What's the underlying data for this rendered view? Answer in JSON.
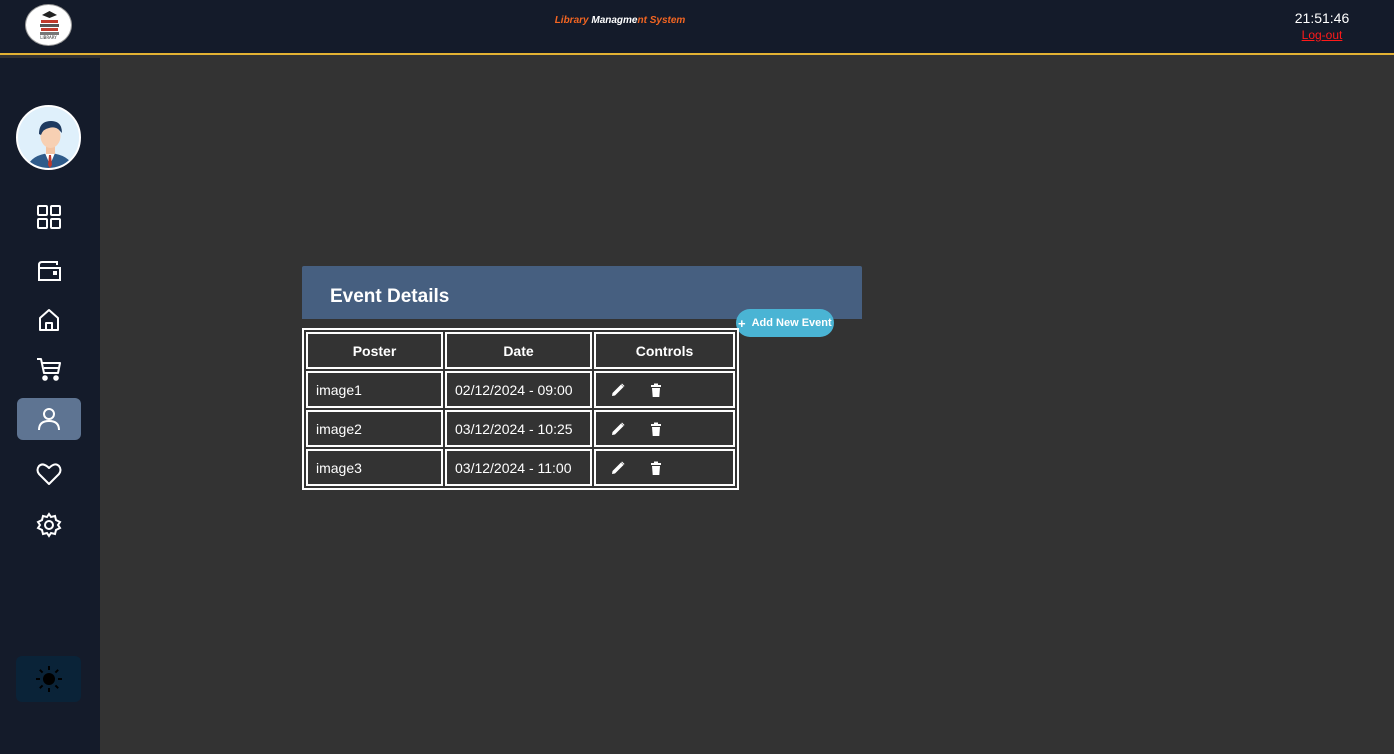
{
  "header": {
    "logo_text": "LIBRARY",
    "title_part1": "Library ",
    "title_part2": "Managme",
    "title_part3": "nt System",
    "clock": "21:51:46",
    "logout_label": "Log-out"
  },
  "sidebar": {
    "items": [
      {
        "icon": "dashboard-icon"
      },
      {
        "icon": "wallet-icon"
      },
      {
        "icon": "home-icon"
      },
      {
        "icon": "cart-icon"
      },
      {
        "icon": "user-icon",
        "active": true
      },
      {
        "icon": "heart-icon"
      },
      {
        "icon": "settings-icon"
      }
    ],
    "theme_icon": "sun-icon"
  },
  "events": {
    "title": "Event Details",
    "add_button_label": "Add New Event",
    "add_button_icon": "+",
    "columns": [
      "Poster",
      "Date",
      "Controls"
    ],
    "rows": [
      {
        "poster": "image1",
        "date": "02/12/2024 - 09:00"
      },
      {
        "poster": "image2",
        "date": "03/12/2024 - 10:25"
      },
      {
        "poster": "image3",
        "date": "03/12/2024 - 11:00"
      }
    ]
  },
  "colors": {
    "accent_border": "#e3b233",
    "title_orange": "#f26522",
    "logout_red": "#ff1a1a",
    "card_header": "#465f80",
    "add_button": "#4ab4d4",
    "active_nav": "#5e7492"
  }
}
